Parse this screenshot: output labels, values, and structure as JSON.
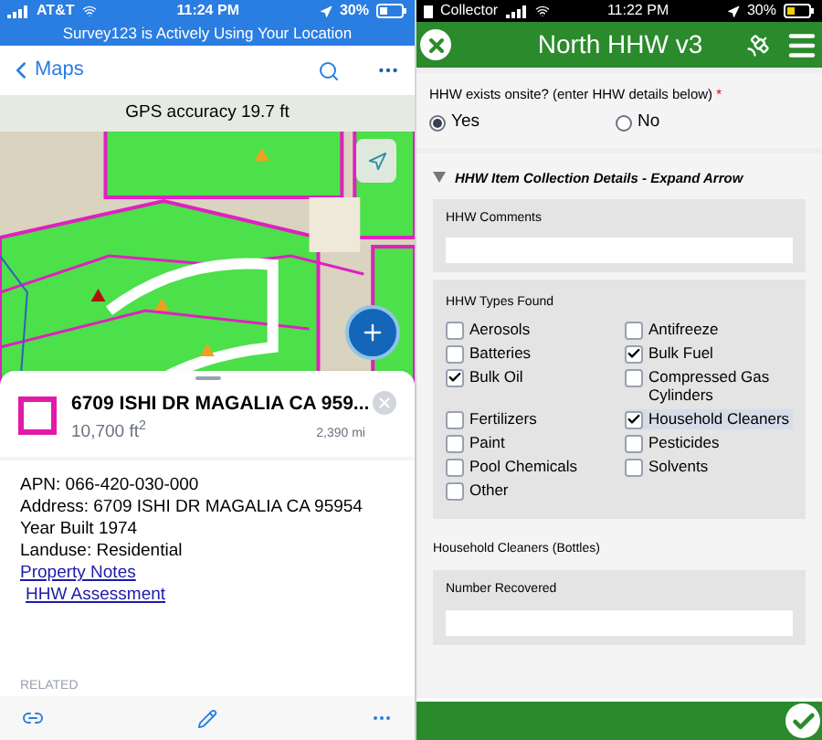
{
  "left": {
    "status_bar": {
      "carrier": "AT&T",
      "time": "11:24 PM",
      "battery": "30%"
    },
    "location_banner": "Survey123 is Actively Using Your Location",
    "nav": {
      "back": "Maps"
    },
    "gps": "GPS accuracy 19.7 ft",
    "feature": {
      "title": "6709 ISHI DR MAGALIA CA 959...",
      "area": "10,700 ft$^{2}$",
      "distance": "2,390 mi"
    },
    "details": [
      {
        "kind": "text",
        "text": "APN: 066-420-030-000"
      },
      {
        "kind": "text",
        "text": "Address: 6709 ISHI DR MAGALIA CA 95954"
      },
      {
        "kind": "text",
        "text": "Year Built 1974"
      },
      {
        "kind": "text",
        "text": "Landuse: Residential"
      },
      {
        "kind": "link",
        "text": "Property Notes"
      },
      {
        "kind": "link",
        "text": "HHW Assessment"
      }
    ],
    "related": "RELATED"
  },
  "right": {
    "status_bar": {
      "app": "Collector",
      "time": "11:22 PM",
      "battery": "30%"
    },
    "header": {
      "title": "North HHW v3"
    },
    "question": {
      "label": "HHW exists onsite? (enter HHW details below)",
      "required": "*",
      "options": [
        {
          "label": "Yes",
          "selected": true
        },
        {
          "label": "No",
          "selected": false
        }
      ]
    },
    "section": {
      "title": "HHW Item Collection Details - Expand Arrow",
      "expanded": true
    },
    "comments": {
      "label": "HHW Comments"
    },
    "types": {
      "label": "HHW Types Found",
      "items": [
        {
          "label": "Aerosols",
          "checked": false,
          "focused": false
        },
        {
          "label": "Antifreeze",
          "checked": false,
          "focused": false
        },
        {
          "label": "Batteries",
          "checked": false,
          "focused": false
        },
        {
          "label": "Bulk Fuel",
          "checked": true,
          "focused": false
        },
        {
          "label": "Bulk Oil",
          "checked": true,
          "focused": false
        },
        {
          "label": "Compressed Gas Cylinders",
          "checked": false,
          "focused": false
        },
        {
          "label": "Fertilizers",
          "checked": false,
          "focused": false
        },
        {
          "label": "Household Cleaners",
          "checked": true,
          "focused": true
        },
        {
          "label": "Paint",
          "checked": false,
          "focused": false
        },
        {
          "label": "Pesticides",
          "checked": false,
          "focused": false
        },
        {
          "label": "Pool Chemicals",
          "checked": false,
          "focused": false
        },
        {
          "label": "Solvents",
          "checked": false,
          "focused": false
        },
        {
          "label": "Other",
          "checked": false,
          "focused": false
        }
      ]
    },
    "subheading": "Household Cleaners (Bottles)",
    "recovered": {
      "label": "Number Recovered"
    }
  }
}
